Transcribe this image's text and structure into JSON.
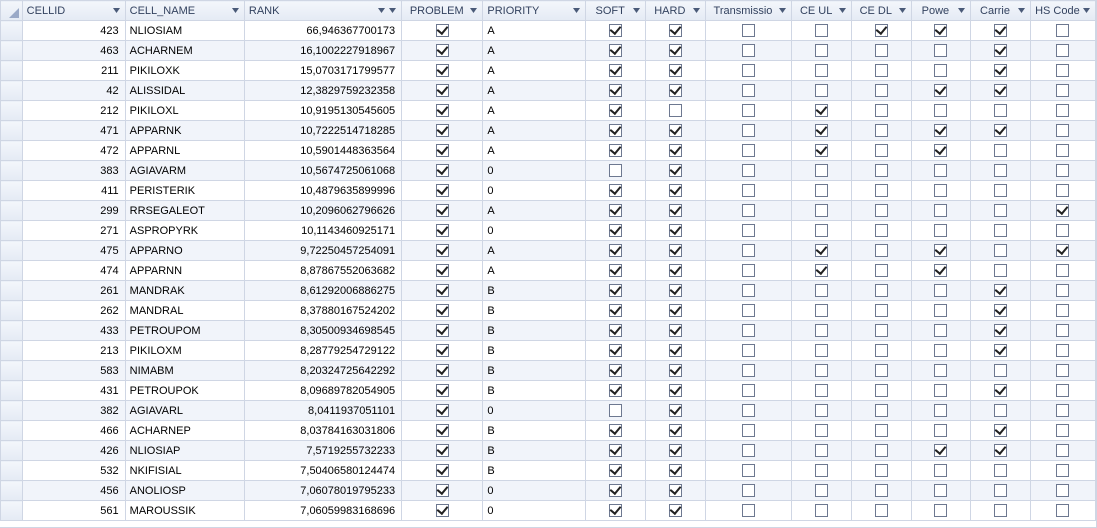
{
  "columns": [
    {
      "key": "cellid",
      "label": "CELLID",
      "align": "num",
      "sort": "none"
    },
    {
      "key": "cellname",
      "label": "CELL_NAME",
      "align": "txt",
      "sort": "none"
    },
    {
      "key": "rank",
      "label": "RANK",
      "align": "num",
      "sort": "desc"
    },
    {
      "key": "problem",
      "label": "PROBLEM",
      "align": "chk",
      "sort": "none"
    },
    {
      "key": "priority",
      "label": "PRIORITY",
      "align": "txt",
      "sort": "none"
    },
    {
      "key": "soft",
      "label": "SOFT",
      "align": "chk",
      "sort": "none"
    },
    {
      "key": "hard",
      "label": "HARD",
      "align": "chk",
      "sort": "none"
    },
    {
      "key": "trans",
      "label": "Transmissio",
      "align": "chk",
      "sort": "none"
    },
    {
      "key": "ceul",
      "label": "CE UL",
      "align": "chk",
      "sort": "none"
    },
    {
      "key": "cedl",
      "label": "CE DL",
      "align": "chk",
      "sort": "none"
    },
    {
      "key": "power",
      "label": "Powe",
      "align": "chk",
      "sort": "none"
    },
    {
      "key": "carrier",
      "label": "Carrie",
      "align": "chk",
      "sort": "none"
    },
    {
      "key": "hscode",
      "label": "HS Code",
      "align": "chk",
      "sort": "none"
    }
  ],
  "rows": [
    {
      "cellid": "423",
      "cellname": "NLIOSIAM",
      "rank": "66,946367700173",
      "problem": true,
      "priority": "A",
      "soft": true,
      "hard": true,
      "trans": false,
      "ceul": false,
      "cedl": true,
      "power": true,
      "carrier": true,
      "hscode": false
    },
    {
      "cellid": "463",
      "cellname": "ACHARNEM",
      "rank": "16,1002227918967",
      "problem": true,
      "priority": "A",
      "soft": true,
      "hard": true,
      "trans": false,
      "ceul": false,
      "cedl": false,
      "power": false,
      "carrier": true,
      "hscode": false
    },
    {
      "cellid": "211",
      "cellname": "PIKILOXK",
      "rank": "15,0703171799577",
      "problem": true,
      "priority": "A",
      "soft": true,
      "hard": true,
      "trans": false,
      "ceul": false,
      "cedl": false,
      "power": false,
      "carrier": true,
      "hscode": false
    },
    {
      "cellid": "42",
      "cellname": "ALISSIDAL",
      "rank": "12,3829759232358",
      "problem": true,
      "priority": "A",
      "soft": true,
      "hard": true,
      "trans": false,
      "ceul": false,
      "cedl": false,
      "power": true,
      "carrier": true,
      "hscode": false
    },
    {
      "cellid": "212",
      "cellname": "PIKILOXL",
      "rank": "10,9195130545605",
      "problem": true,
      "priority": "A",
      "soft": true,
      "hard": false,
      "trans": false,
      "ceul": true,
      "cedl": false,
      "power": false,
      "carrier": false,
      "hscode": false
    },
    {
      "cellid": "471",
      "cellname": "APPARNK",
      "rank": "10,7222514718285",
      "problem": true,
      "priority": "A",
      "soft": true,
      "hard": true,
      "trans": false,
      "ceul": true,
      "cedl": false,
      "power": true,
      "carrier": true,
      "hscode": false
    },
    {
      "cellid": "472",
      "cellname": "APPARNL",
      "rank": "10,5901448363564",
      "problem": true,
      "priority": "A",
      "soft": true,
      "hard": true,
      "trans": false,
      "ceul": true,
      "cedl": false,
      "power": true,
      "carrier": false,
      "hscode": false
    },
    {
      "cellid": "383",
      "cellname": "AGIAVARM",
      "rank": "10,5674725061068",
      "problem": true,
      "priority": "0",
      "soft": false,
      "hard": true,
      "trans": false,
      "ceul": false,
      "cedl": false,
      "power": false,
      "carrier": false,
      "hscode": false
    },
    {
      "cellid": "411",
      "cellname": "PERISTERIK",
      "rank": "10,4879635899996",
      "problem": true,
      "priority": "0",
      "soft": true,
      "hard": true,
      "trans": false,
      "ceul": false,
      "cedl": false,
      "power": false,
      "carrier": false,
      "hscode": false
    },
    {
      "cellid": "299",
      "cellname": "RRSEGALEOT",
      "rank": "10,2096062796626",
      "problem": true,
      "priority": "A",
      "soft": true,
      "hard": true,
      "trans": false,
      "ceul": false,
      "cedl": false,
      "power": false,
      "carrier": false,
      "hscode": true
    },
    {
      "cellid": "271",
      "cellname": "ASPROPYRK",
      "rank": "10,1143460925171",
      "problem": true,
      "priority": "0",
      "soft": true,
      "hard": true,
      "trans": false,
      "ceul": false,
      "cedl": false,
      "power": false,
      "carrier": false,
      "hscode": false
    },
    {
      "cellid": "475",
      "cellname": "APPARNO",
      "rank": "9,72250457254091",
      "problem": true,
      "priority": "A",
      "soft": true,
      "hard": true,
      "trans": false,
      "ceul": true,
      "cedl": false,
      "power": true,
      "carrier": false,
      "hscode": true
    },
    {
      "cellid": "474",
      "cellname": "APPARNN",
      "rank": "8,87867552063682",
      "problem": true,
      "priority": "A",
      "soft": true,
      "hard": true,
      "trans": false,
      "ceul": true,
      "cedl": false,
      "power": true,
      "carrier": false,
      "hscode": false
    },
    {
      "cellid": "261",
      "cellname": "MANDRAK",
      "rank": "8,61292006886275",
      "problem": true,
      "priority": "B",
      "soft": true,
      "hard": true,
      "trans": false,
      "ceul": false,
      "cedl": false,
      "power": false,
      "carrier": true,
      "hscode": false
    },
    {
      "cellid": "262",
      "cellname": "MANDRAL",
      "rank": "8,37880167524202",
      "problem": true,
      "priority": "B",
      "soft": true,
      "hard": true,
      "trans": false,
      "ceul": false,
      "cedl": false,
      "power": false,
      "carrier": true,
      "hscode": false
    },
    {
      "cellid": "433",
      "cellname": "PETROUPOM",
      "rank": "8,30500934698545",
      "problem": true,
      "priority": "B",
      "soft": true,
      "hard": true,
      "trans": false,
      "ceul": false,
      "cedl": false,
      "power": false,
      "carrier": true,
      "hscode": false
    },
    {
      "cellid": "213",
      "cellname": "PIKILOXM",
      "rank": "8,28779254729122",
      "problem": true,
      "priority": "B",
      "soft": true,
      "hard": true,
      "trans": false,
      "ceul": false,
      "cedl": false,
      "power": false,
      "carrier": true,
      "hscode": false
    },
    {
      "cellid": "583",
      "cellname": "NIMABM",
      "rank": "8,20324725642292",
      "problem": true,
      "priority": "B",
      "soft": true,
      "hard": true,
      "trans": false,
      "ceul": false,
      "cedl": false,
      "power": false,
      "carrier": false,
      "hscode": false
    },
    {
      "cellid": "431",
      "cellname": "PETROUPOK",
      "rank": "8,09689782054905",
      "problem": true,
      "priority": "B",
      "soft": true,
      "hard": true,
      "trans": false,
      "ceul": false,
      "cedl": false,
      "power": false,
      "carrier": true,
      "hscode": false
    },
    {
      "cellid": "382",
      "cellname": "AGIAVARL",
      "rank": "8,0411937051101",
      "problem": true,
      "priority": "0",
      "soft": false,
      "hard": true,
      "trans": false,
      "ceul": false,
      "cedl": false,
      "power": false,
      "carrier": false,
      "hscode": false
    },
    {
      "cellid": "466",
      "cellname": "ACHARNEP",
      "rank": "8,03784163031806",
      "problem": true,
      "priority": "B",
      "soft": true,
      "hard": true,
      "trans": false,
      "ceul": false,
      "cedl": false,
      "power": false,
      "carrier": true,
      "hscode": false
    },
    {
      "cellid": "426",
      "cellname": "NLIOSIAP",
      "rank": "7,5719255732233",
      "problem": true,
      "priority": "B",
      "soft": true,
      "hard": true,
      "trans": false,
      "ceul": false,
      "cedl": false,
      "power": true,
      "carrier": true,
      "hscode": false
    },
    {
      "cellid": "532",
      "cellname": "NKIFISIAL",
      "rank": "7,50406580124474",
      "problem": true,
      "priority": "B",
      "soft": true,
      "hard": true,
      "trans": false,
      "ceul": false,
      "cedl": false,
      "power": false,
      "carrier": false,
      "hscode": false
    },
    {
      "cellid": "456",
      "cellname": "ANOLIOSP",
      "rank": "7,06078019795233",
      "problem": true,
      "priority": "0",
      "soft": true,
      "hard": true,
      "trans": false,
      "ceul": false,
      "cedl": false,
      "power": false,
      "carrier": false,
      "hscode": false
    },
    {
      "cellid": "561",
      "cellname": "MAROUSSIK",
      "rank": "7,06059983168696",
      "problem": true,
      "priority": "0",
      "soft": true,
      "hard": true,
      "trans": false,
      "ceul": false,
      "cedl": false,
      "power": false,
      "carrier": false,
      "hscode": false
    }
  ]
}
